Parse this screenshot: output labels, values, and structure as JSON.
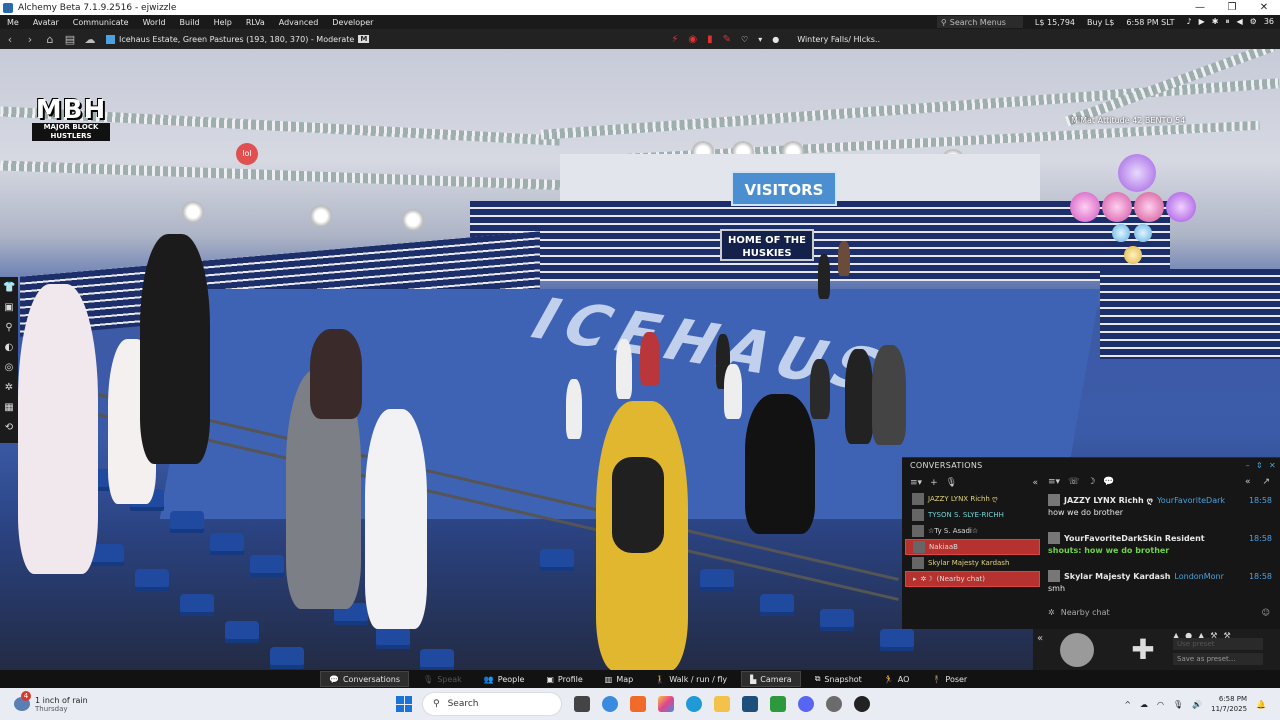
{
  "window": {
    "title": "Alchemy Beta 7.1.9.2516 - ejwizzle",
    "controls": [
      "—",
      "❐",
      "✕"
    ]
  },
  "menubar": {
    "items": [
      "Me",
      "Avatar",
      "Communicate",
      "World",
      "Build",
      "Help",
      "RLVa",
      "Advanced",
      "Developer"
    ],
    "search_placeholder": "Search Menus",
    "balance": "L$ 15,794",
    "buy": "Buy L$",
    "time": "6:58 PM SLT",
    "counter": "36"
  },
  "navbar": {
    "location": "Icehaus Estate, Green Pastures (193, 180, 370) - Moderate",
    "maturity": "M",
    "favorite": "Wintery Falls/ Hlcks.."
  },
  "scene": {
    "logo_big": "MBH",
    "logo_small": "MAJOR BLOCK HUSTLERS",
    "banner_visitors": "VISITORS",
    "banner_home": "HOME OF THE HUSKIES",
    "floor_text": "ICEHAUS",
    "float_text": "MiMat Attitude 42 BENTO 54",
    "corner_badge": "lol"
  },
  "conversations": {
    "title": "CONVERSATIONS",
    "list": [
      {
        "name": "JAZZY LYNX  Richh ღ",
        "style": "gold",
        "selected": false
      },
      {
        "name": "TYSON S. SLYE-RICHH",
        "style": "cyan",
        "selected": false
      },
      {
        "name": "☆Ty S. Asadi☆",
        "style": "",
        "selected": false
      },
      {
        "name": "NakiaaB",
        "style": "",
        "selected": true
      },
      {
        "name": "Skylar Majesty Kardash",
        "style": "gold",
        "selected": false
      },
      {
        "name": "(Nearby chat)",
        "style": "",
        "selected": true
      }
    ],
    "messages": [
      {
        "sender": "JAZZY LYNX  Richh ღ",
        "handle": "YourFavoriteDark",
        "time": "18:58",
        "text": "how we do brother",
        "green": false
      },
      {
        "sender": "YourFavoriteDarkSkin Resident",
        "handle": "",
        "time": "18:58",
        "text": "shouts: how we do brother",
        "green": true
      },
      {
        "sender": "Skylar Majesty Kardash",
        "handle": "LondonMonr",
        "time": "18:58",
        "text": "smh",
        "green": false
      }
    ],
    "input_placeholder": "Nearby chat"
  },
  "camera_ctrl": {
    "preset_placeholder": "Use preset",
    "save_preset": "Save as preset..."
  },
  "bottom_toolbar": {
    "conversations": "Conversations",
    "speak": "Speak",
    "people": "People",
    "profile": "Profile",
    "map": "Map",
    "walk": "Walk / run / fly",
    "camera": "Camera",
    "snapshot": "Snapshot",
    "ao": "AO",
    "poser": "Poser"
  },
  "taskbar": {
    "weather_badge": "4",
    "weather_title": "1 inch of rain",
    "weather_day": "Thursday",
    "search": "Search",
    "time": "6:58 PM",
    "date": "11/7/2025"
  },
  "colors": {
    "accent": "#4aa3e0",
    "selection": "#b5322e",
    "green_chat": "#6fd14a",
    "floor": "#3b5ba8"
  }
}
